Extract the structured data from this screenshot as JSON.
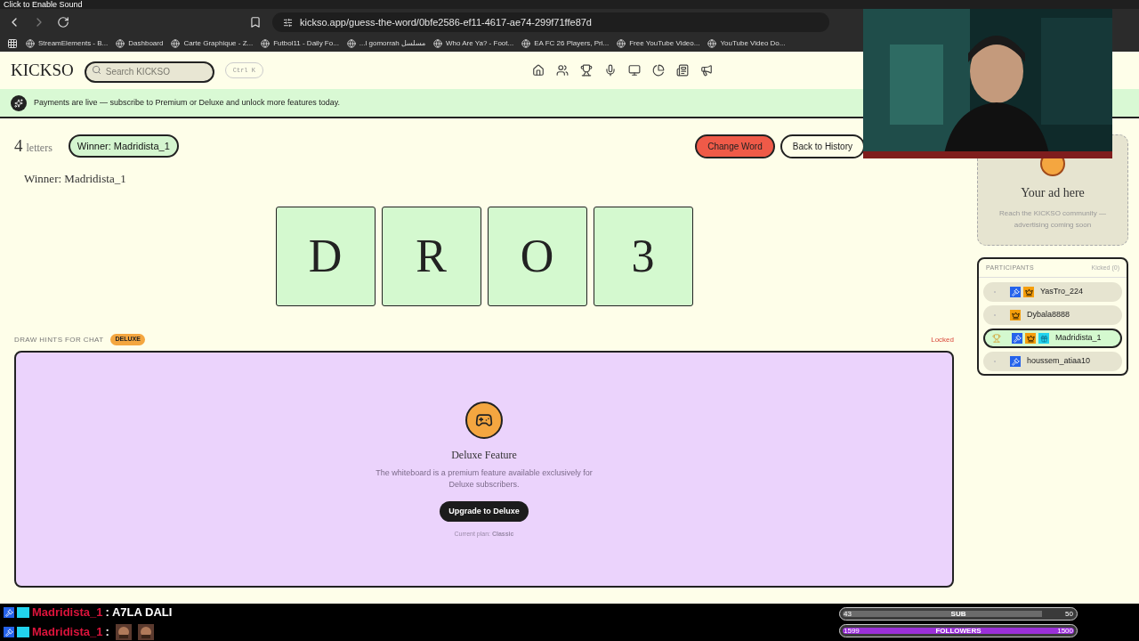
{
  "browser": {
    "tab_overlay": "Click to Enable Sound",
    "url": "kickso.app/guess-the-word/0bfe2586-ef11-4617-ae74-299f71ffe87d",
    "bookmarks": [
      {
        "label": "StreamElements - B..."
      },
      {
        "label": "Dashboard"
      },
      {
        "label": "Carte Graphique - Z..."
      },
      {
        "label": "Futbol11 - Daily Fo..."
      },
      {
        "label": "...l gomorrah مسلسل"
      },
      {
        "label": "Who Are Ya? - Foot..."
      },
      {
        "label": "EA FC 26 Players, Pri..."
      },
      {
        "label": "Free YouTube Video..."
      },
      {
        "label": "YouTube Video Do..."
      }
    ]
  },
  "header": {
    "logo": "KICKSO",
    "search_placeholder": "Search KICKSO",
    "shortcut": "Ctrl K"
  },
  "banner": {
    "text": "Payments are live — subscribe to Premium or Deluxe and unlock more features today."
  },
  "game": {
    "count": "4",
    "count_label": "letters",
    "winner_pill": "Winner: Madridista_1",
    "winner_text": "Winner: Madridista_1",
    "buttons": [
      {
        "label": "Change Word",
        "kind": "danger"
      },
      {
        "label": "Back to History",
        "kind": "outline"
      }
    ],
    "tiles": [
      "D",
      "R",
      "O",
      "3"
    ]
  },
  "hints": {
    "title": "DRAW HINTS FOR CHAT",
    "badge": "DELUXE",
    "status": "Locked",
    "feature_title": "Deluxe Feature",
    "description": "The whiteboard is a premium feature available exclusively for Deluxe subscribers.",
    "cta": "Upgrade to Deluxe",
    "plan_label": "Current plan:",
    "plan": "Classic"
  },
  "ad": {
    "title": "Your ad here",
    "text": "Reach the KICKSO community — advertising coming soon"
  },
  "participants": {
    "title": "PARTICIPANTS",
    "kicked": "Kicked (0)",
    "items": [
      {
        "name": "YasTro_224",
        "selected": false,
        "moderator": true,
        "crown": true,
        "gift": false
      },
      {
        "name": "Dybala8888",
        "selected": false,
        "moderator": false,
        "crown": true,
        "gift": false
      },
      {
        "name": "Madridista_1",
        "selected": true,
        "moderator": true,
        "crown": true,
        "gift": true
      },
      {
        "name": "houssem_atiaa10",
        "selected": false,
        "moderator": true,
        "crown": false,
        "gift": false
      }
    ]
  },
  "chat": [
    {
      "user": "Madridista_1",
      "message": ": A7LA DALI"
    },
    {
      "user": "Madridista_1",
      "message": ":"
    }
  ],
  "goals": [
    {
      "start": "43",
      "label": "SUB",
      "end": "50",
      "level": 0.86
    },
    {
      "start": "1599",
      "label": "FOLLOWERS",
      "end": "1500",
      "level": 1
    }
  ]
}
